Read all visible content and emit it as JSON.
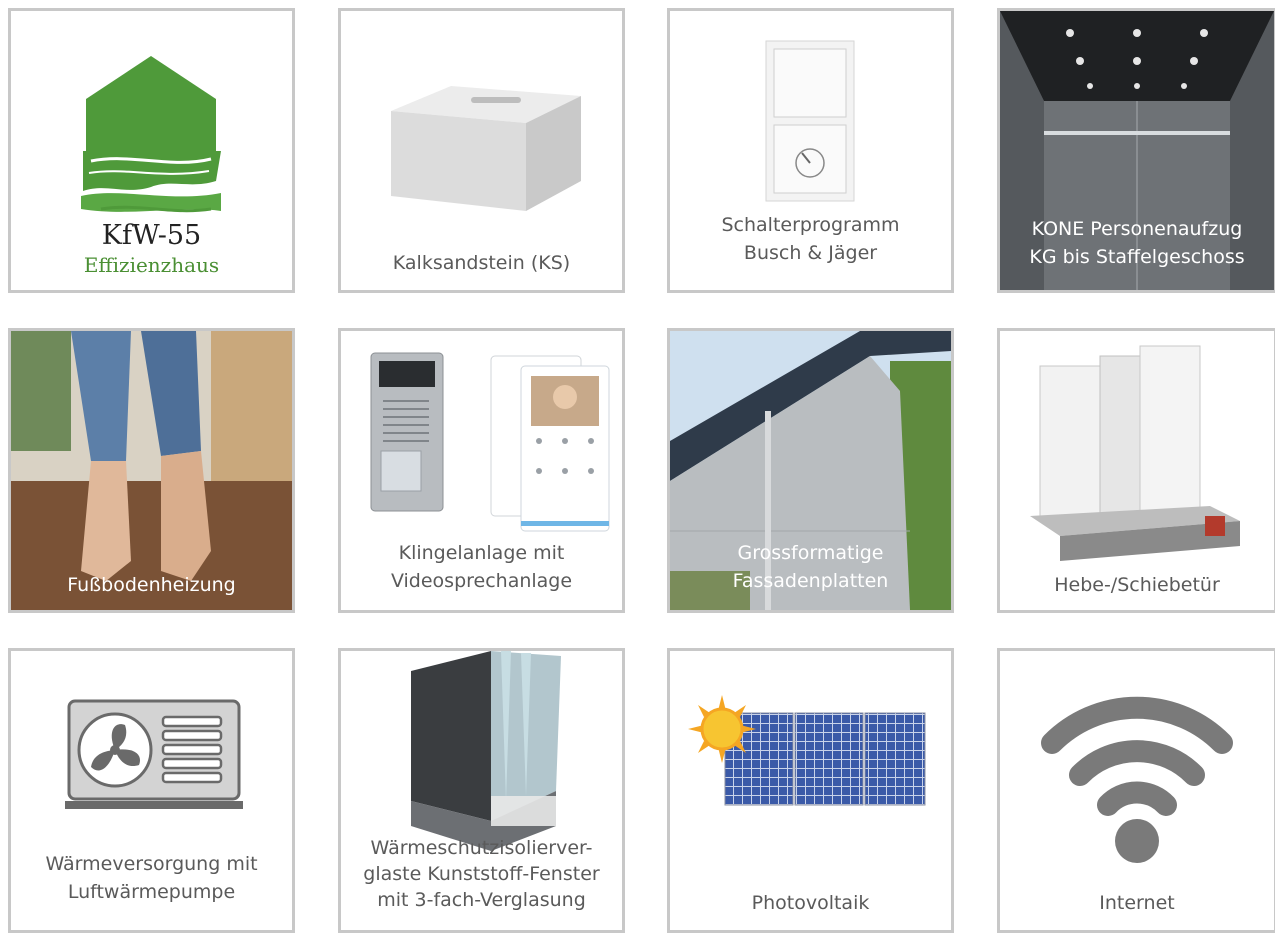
{
  "tiles": [
    {
      "id": "kfw",
      "title": "KfW-55",
      "subtitle": "Effizienzhaus",
      "icon": "green-house-logo"
    },
    {
      "id": "ks",
      "lines": [
        "Kalksandstein (KS)"
      ],
      "icon": "sand-lime-brick-image"
    },
    {
      "id": "schalter",
      "lines": [
        "Schalterprogramm",
        "Busch & Jäger"
      ],
      "icon": "light-switch-image"
    },
    {
      "id": "kone",
      "lines": [
        "KONE Personenaufzug",
        "KG bis Staffelgeschoss"
      ],
      "icon": "elevator-interior-image"
    },
    {
      "id": "floor",
      "lines": [
        "Fußbodenheizung"
      ],
      "icon": "barefoot-floor-heating-image"
    },
    {
      "id": "klingel",
      "lines": [
        "Klingelanlage mit",
        "Videosprechanlage"
      ],
      "icon": "intercom-image"
    },
    {
      "id": "fassade",
      "lines": [
        "Grossformatige",
        "Fassadenplatten"
      ],
      "icon": "facade-image"
    },
    {
      "id": "hebe",
      "lines": [
        "Hebe-/Schiebetür"
      ],
      "icon": "sliding-door-profile-image"
    },
    {
      "id": "waerme",
      "lines": [
        "Wärmeversorgung mit",
        "Luftwärmepumpe"
      ],
      "icon": "heat-pump-icon"
    },
    {
      "id": "fenster",
      "lines": [
        "Wärmeschutzisolierver-",
        "glaste Kunststoff-Fenster",
        "mit 3-fach-Verglasung"
      ],
      "icon": "window-profile-image"
    },
    {
      "id": "pv",
      "lines": [
        "Photovoltaik"
      ],
      "icon": "solar-panel-icon"
    },
    {
      "id": "internet",
      "lines": [
        "Internet"
      ],
      "icon": "wifi-icon"
    }
  ],
  "colors": {
    "border": "#c8c8c8",
    "caption": "#5a5a5a",
    "kfw_green": "#4a8f33",
    "accent_sun": "#f5a623"
  }
}
